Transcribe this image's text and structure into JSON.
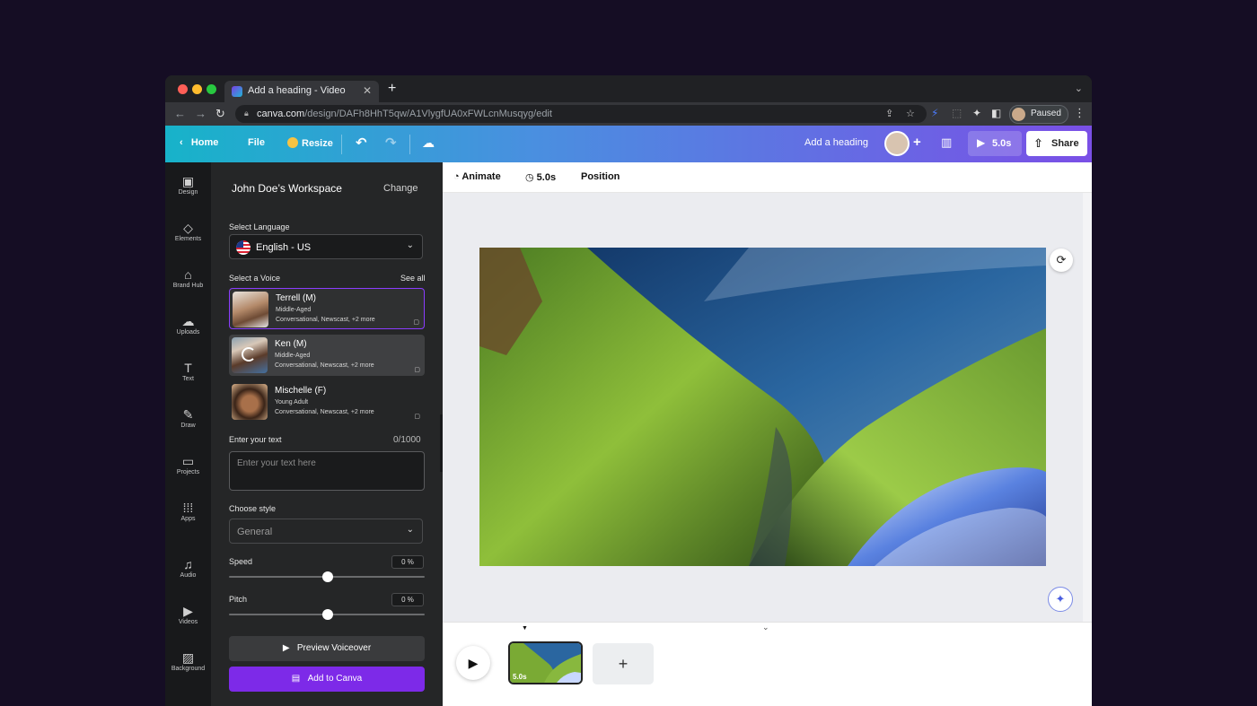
{
  "browser": {
    "tab_title": "Add a heading - Video",
    "tab_close": "✕",
    "new_tab": "+",
    "url_host": "canva.com",
    "url_path": "/design/DAFh8HhT5qw/A1VlygfUA0xFWLcnMusqyg/edit",
    "profile_status": "Paused"
  },
  "header": {
    "home": "Home",
    "file": "File",
    "resize": "Resize",
    "design_title": "Add a heading",
    "duration": "5.0s",
    "share": "Share"
  },
  "rail": [
    {
      "label": "Design",
      "icon": "▣"
    },
    {
      "label": "Elements",
      "icon": "◇"
    },
    {
      "label": "Brand Hub",
      "icon": "⌂"
    },
    {
      "label": "Uploads",
      "icon": "☁"
    },
    {
      "label": "Text",
      "icon": "T"
    },
    {
      "label": "Draw",
      "icon": "✎"
    },
    {
      "label": "Projects",
      "icon": "▭"
    },
    {
      "label": "Apps",
      "icon": "⁞⁞⁞"
    },
    {
      "label": "Audio",
      "icon": "♫"
    },
    {
      "label": "Videos",
      "icon": "▶"
    },
    {
      "label": "Background",
      "icon": "▨"
    }
  ],
  "panel": {
    "workspace": "John Doe’s Workspace",
    "change": "Change",
    "select_language_label": "Select Language",
    "language": "English - US",
    "select_voice_label": "Select a Voice",
    "see_all": "See all",
    "voices": [
      {
        "name": "Terrell (M)",
        "age": "Middle-Aged",
        "tags": "Conversational, Newscast, +2 more"
      },
      {
        "name": "Ken (M)",
        "age": "Middle-Aged",
        "tags": "Conversational, Newscast, +2 more"
      },
      {
        "name": "Mischelle (F)",
        "age": "Young Adult",
        "tags": "Conversational, Newscast, +2 more"
      }
    ],
    "enter_text_label": "Enter your text",
    "char_count": "0/1000",
    "text_placeholder": "Enter your text here",
    "choose_style_label": "Choose style",
    "style": "General",
    "speed_label": "Speed",
    "speed_value": "0 %",
    "pitch_label": "Pitch",
    "pitch_value": "0 %",
    "preview_btn": "Preview Voiceover",
    "add_btn": "Add to Canva"
  },
  "canvas_toolbar": {
    "animate": "Animate",
    "time": "5.0s",
    "position": "Position"
  },
  "timeline": {
    "page_duration": "5.0s"
  },
  "colors": {
    "accent_purple": "#7d2ae8",
    "header_start": "#17b3c9",
    "header_end": "#7a4fe6"
  }
}
